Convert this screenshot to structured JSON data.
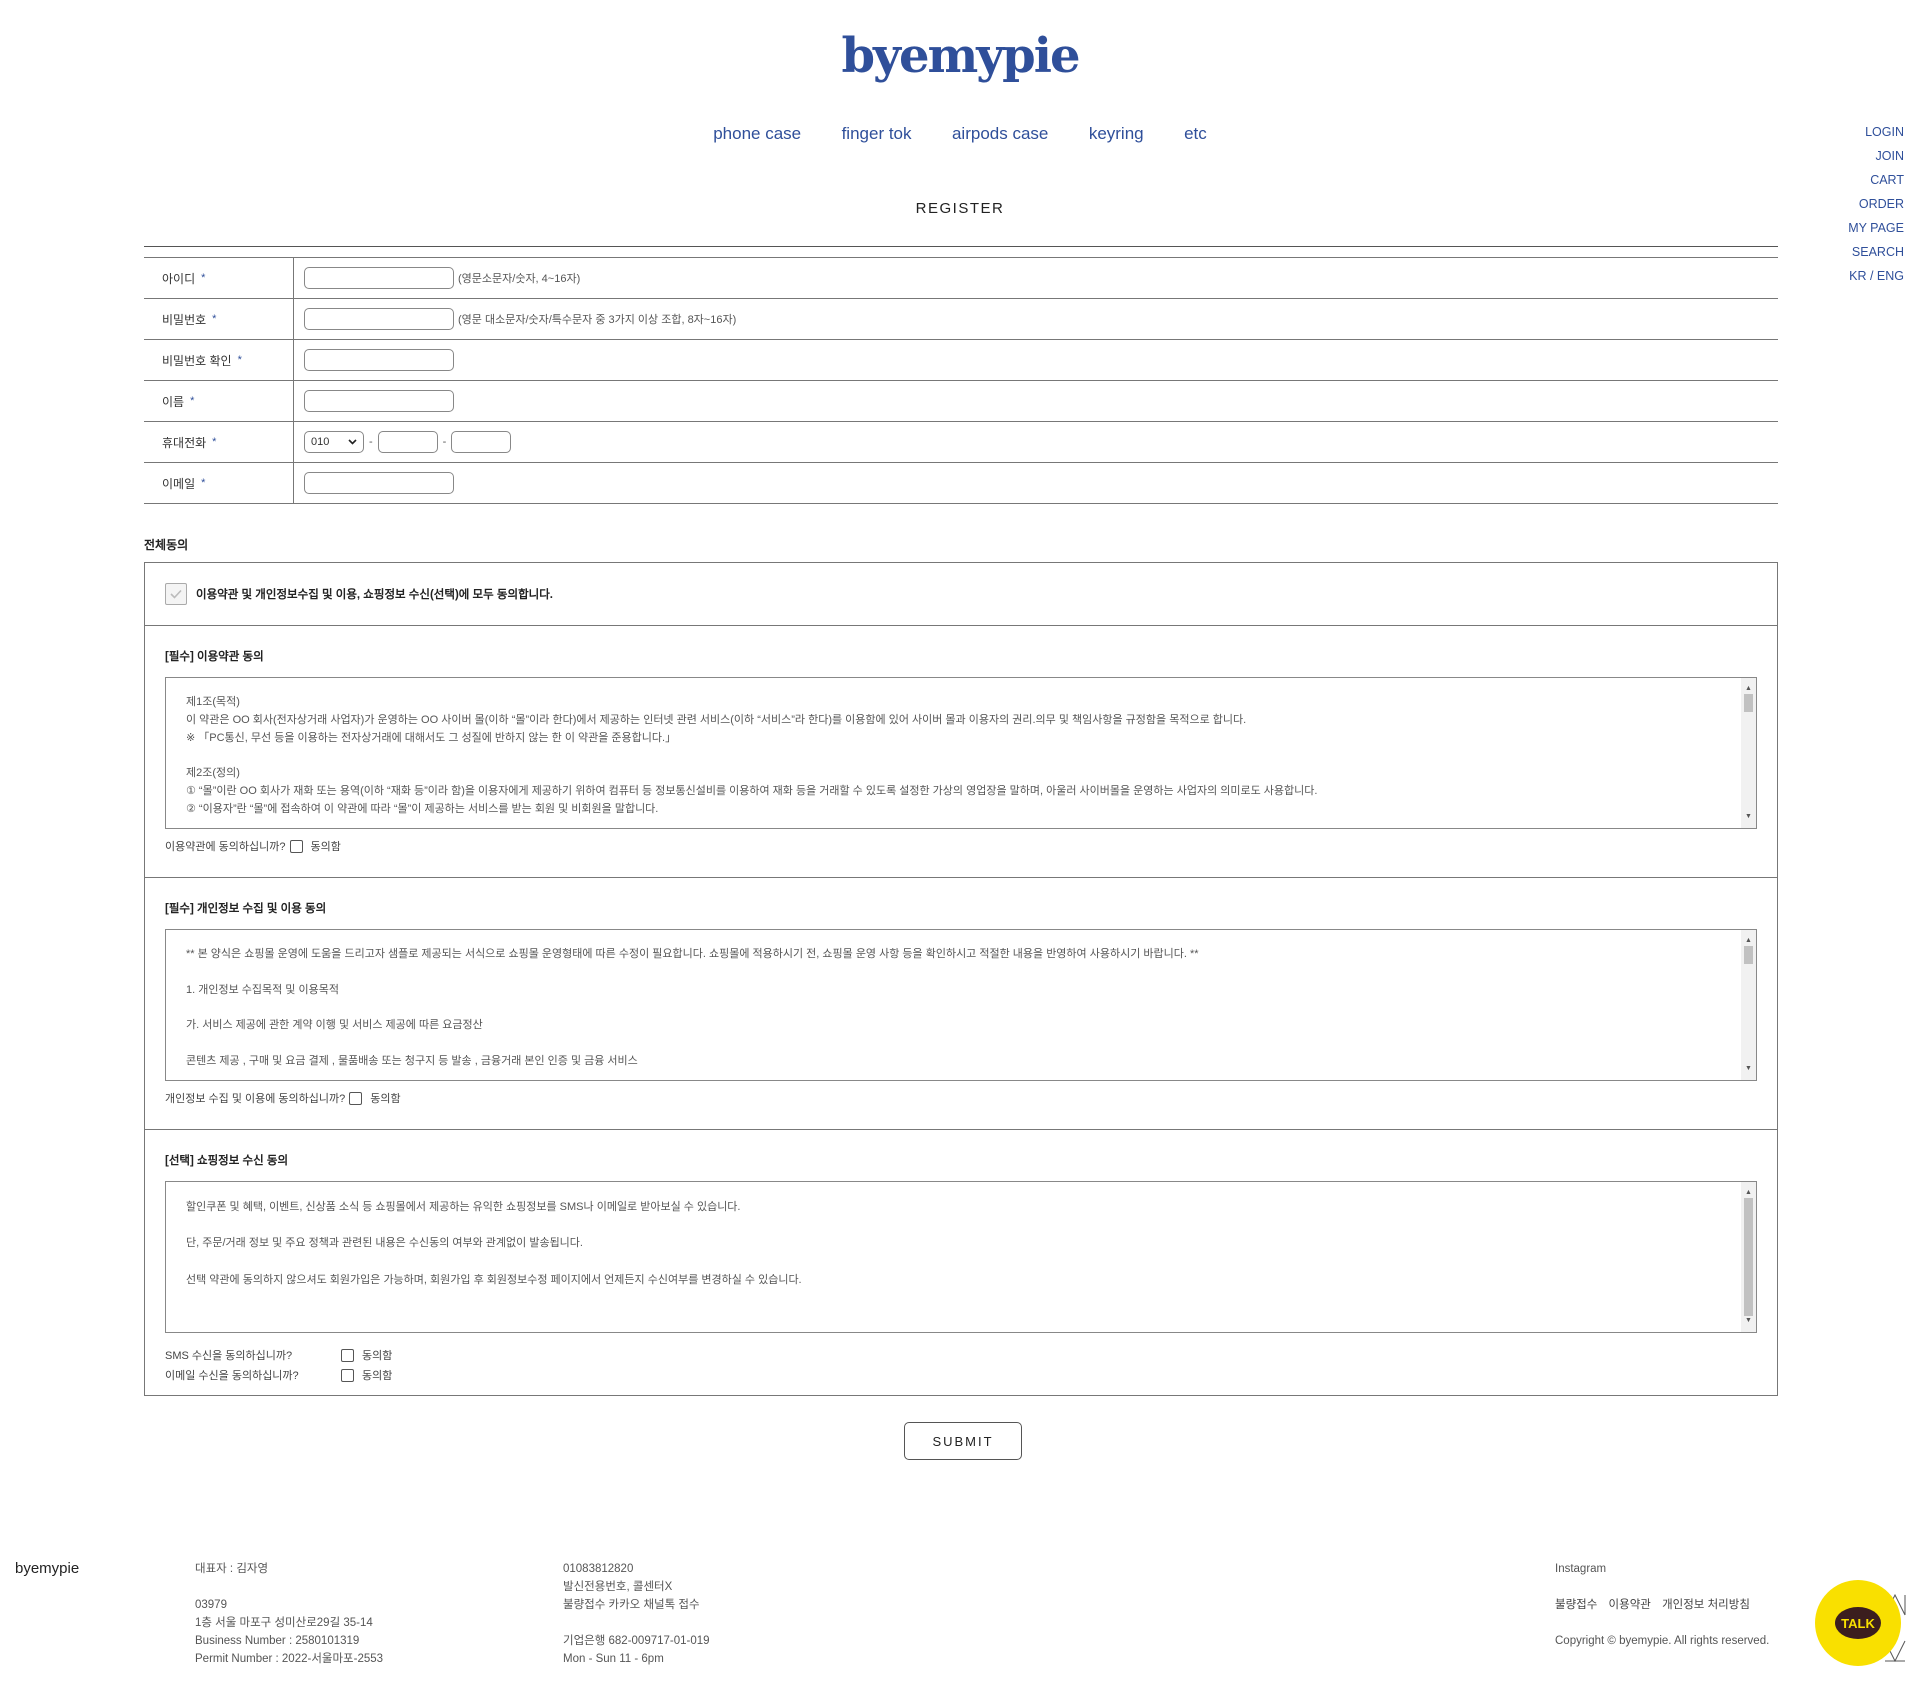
{
  "brand": {
    "logo": "byemypie"
  },
  "nav": {
    "items": [
      "phone case",
      "finger tok",
      "airpods case",
      "keyring",
      "etc"
    ]
  },
  "side_menu": [
    "LOGIN",
    "JOIN",
    "CART",
    "ORDER",
    "MY PAGE",
    "SEARCH",
    "KR / ENG"
  ],
  "page_title": "REGISTER",
  "form": {
    "required_mark": "*",
    "id_label": "아이디",
    "id_hint": "(영문소문자/숫자, 4~16자)",
    "password_label": "비밀번호",
    "password_hint": "(영문 대소문자/숫자/특수문자 중 3가지 이상 조합, 8자~16자)",
    "password_confirm_label": "비밀번호 확인",
    "name_label": "이름",
    "phone_label": "휴대전화",
    "phone_prefix": "010",
    "phone_dash": "-",
    "email_label": "이메일"
  },
  "agreement": {
    "title": "전체동의",
    "all_text": "이용약관 및 개인정보수집 및 이용, 쇼핑정보 수신(선택)에 모두 동의합니다.",
    "terms": {
      "title": "[필수] 이용약관 동의",
      "lines": [
        "제1조(목적)",
        "이 약관은 OO 회사(전자상거래 사업자)가 운영하는 OO 사이버 몰(이하 “몰”이라 한다)에서 제공하는 인터넷 관련 서비스(이하 “서비스”라 한다)를 이용함에 있어 사이버 몰과 이용자의 권리.의무 및 책임사항을 규정함을 목적으로 합니다.",
        "※ 「PC통신, 무선 등을 이용하는 전자상거래에 대해서도 그 성질에 반하지 않는 한 이 약관을 준용합니다.」",
        "",
        "제2조(정의)",
        "① “몰”이란 OO 회사가 재화 또는 용역(이하 “재화 등”이라 함)을 이용자에게 제공하기 위하여 컴퓨터 등 정보통신설비를 이용하여 재화 등을 거래할 수 있도록 설정한 가상의 영업장을 말하며, 아울러 사이버몰을 운영하는 사업자의 의미로도 사용합니다.",
        "② “이용자”란 “몰”에 접속하여 이 약관에 따라 “몰”이 제공하는 서비스를 받는 회원 및 비회원을 말합니다."
      ],
      "question": "이용약관에 동의하십니까?",
      "agree": "동의함"
    },
    "privacy": {
      "title": "[필수] 개인정보 수집 및 이용 동의",
      "lines": [
        " ** 본 양식은 쇼핑몰 운영에 도움을 드리고자 샘플로 제공되는 서식으로 쇼핑몰 운영형태에 따른 수정이 필요합니다. 쇼핑몰에 적용하시기 전, 쇼핑몰 운영 사항 등을 확인하시고 적절한 내용을 반영하여 사용하시기 바랍니다. **",
        "",
        "1. 개인정보 수집목적 및 이용목적",
        "",
        "가. 서비스 제공에 관한 계약 이행 및 서비스 제공에 따른 요금정산",
        "",
        "콘텐츠 제공 , 구매 및 요금 결제 , 물품배송 또는 청구지 등 발송 , 금융거래 본인 인증 및 금융 서비스"
      ],
      "question": "개인정보 수집 및 이용에 동의하십니까?",
      "agree": "동의함"
    },
    "shopping": {
      "title": "[선택] 쇼핑정보 수신 동의",
      "lines": [
        "할인쿠폰 및 혜택, 이벤트, 신상품 소식 등 쇼핑몰에서 제공하는 유익한 쇼핑정보를 SMS나 이메일로 받아보실 수 있습니다.",
        "",
        "단, 주문/거래 정보 및 주요 정책과 관련된 내용은 수신동의 여부와 관계없이 발송됩니다.",
        "",
        "선택 약관에 동의하지 않으셔도 회원가입은 가능하며, 회원가입 후 회원정보수정 페이지에서 언제든지 수신여부를 변경하실 수 있습니다."
      ],
      "sms_question": "SMS 수신을 동의하십니까?",
      "email_question": "이메일 수신을 동의하십니까?",
      "agree": "동의함"
    }
  },
  "submit_label": "SUBMIT",
  "footer": {
    "brand": "byemypie",
    "col1": [
      "대표자 : 김자영",
      "",
      "03979",
      "1층 서울 마포구 성미산로29길 35-14",
      "Business Number : 2580101319",
      "Permit Number : 2022-서울마포-2553"
    ],
    "col2": [
      "01083812820",
      "발신전용번호, 콜센터X",
      "불량접수 카카오 채널톡 접수",
      "",
      "기업은행 682-009717-01-019",
      "Mon - Sun 11 - 6pm"
    ],
    "instagram": "Instagram",
    "links": [
      "불량접수",
      "이용약관",
      "개인정보 처리방침"
    ],
    "copyright": "Copyright © byemypie. All rights reserved.",
    "talk_label": "TALK"
  },
  "colors": {
    "accent": "#2f4f9a",
    "talk_yellow": "#f9e000",
    "talk_brown": "#3b1e1e"
  }
}
